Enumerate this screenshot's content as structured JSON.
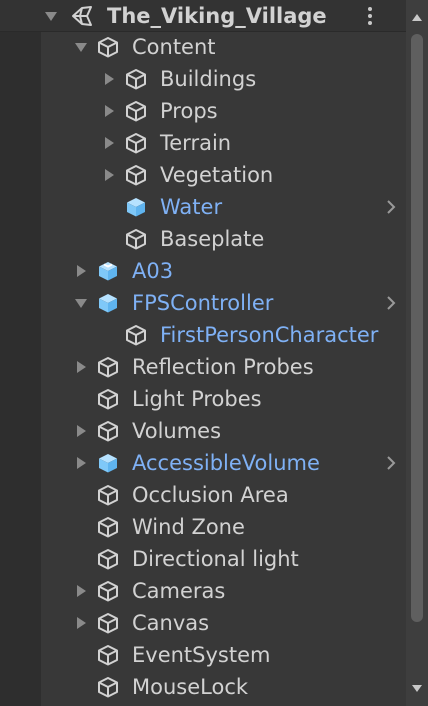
{
  "scene": {
    "name": "The_Viking_Village"
  },
  "hierarchy": {
    "items": [
      {
        "label": "Content",
        "type": "gameobject",
        "expand": "expanded"
      },
      {
        "label": "Buildings",
        "type": "gameobject",
        "expand": "collapsed"
      },
      {
        "label": "Props",
        "type": "gameobject",
        "expand": "collapsed"
      },
      {
        "label": "Terrain",
        "type": "gameobject",
        "expand": "collapsed"
      },
      {
        "label": "Vegetation",
        "type": "gameobject",
        "expand": "collapsed"
      },
      {
        "label": "Water",
        "type": "prefab",
        "expand": "none",
        "has_chevron": true
      },
      {
        "label": "Baseplate",
        "type": "gameobject",
        "expand": "none"
      },
      {
        "label": "A03",
        "type": "prefab-model",
        "expand": "collapsed"
      },
      {
        "label": "FPSController",
        "type": "prefab",
        "expand": "expanded",
        "has_chevron": true
      },
      {
        "label": "FirstPersonCharacter",
        "type": "gameobject",
        "expand": "none",
        "blue_text": true
      },
      {
        "label": "Reflection Probes",
        "type": "gameobject",
        "expand": "collapsed"
      },
      {
        "label": "Light Probes",
        "type": "gameobject",
        "expand": "none"
      },
      {
        "label": "Volumes",
        "type": "gameobject",
        "expand": "collapsed"
      },
      {
        "label": "AccessibleVolume",
        "type": "prefab",
        "expand": "collapsed",
        "has_chevron": true
      },
      {
        "label": "Occlusion Area",
        "type": "gameobject",
        "expand": "none"
      },
      {
        "label": "Wind Zone",
        "type": "gameobject",
        "expand": "none"
      },
      {
        "label": "Directional light",
        "type": "gameobject",
        "expand": "none"
      },
      {
        "label": "Cameras",
        "type": "gameobject",
        "expand": "collapsed"
      },
      {
        "label": "Canvas",
        "type": "gameobject",
        "expand": "collapsed"
      },
      {
        "label": "EventSystem",
        "type": "gameobject",
        "expand": "none"
      },
      {
        "label": "MouseLock",
        "type": "gameobject",
        "expand": "none"
      }
    ]
  },
  "colors": {
    "background": "#383838",
    "text": "#d2d2d2",
    "prefab_text": "#7fb1f5",
    "prefab_icon": "#7fc8f8",
    "icon_outline": "#d2d2d2",
    "arrow": "#8a8a8a"
  },
  "icons": {
    "scene": "unity-scene-icon",
    "gameobject": "cube-icon",
    "prefab": "prefab-cube-icon",
    "prefab_model": "model-prefab-icon",
    "menu": "kebab-menu-icon",
    "open_prefab": "chevron-right-icon"
  }
}
